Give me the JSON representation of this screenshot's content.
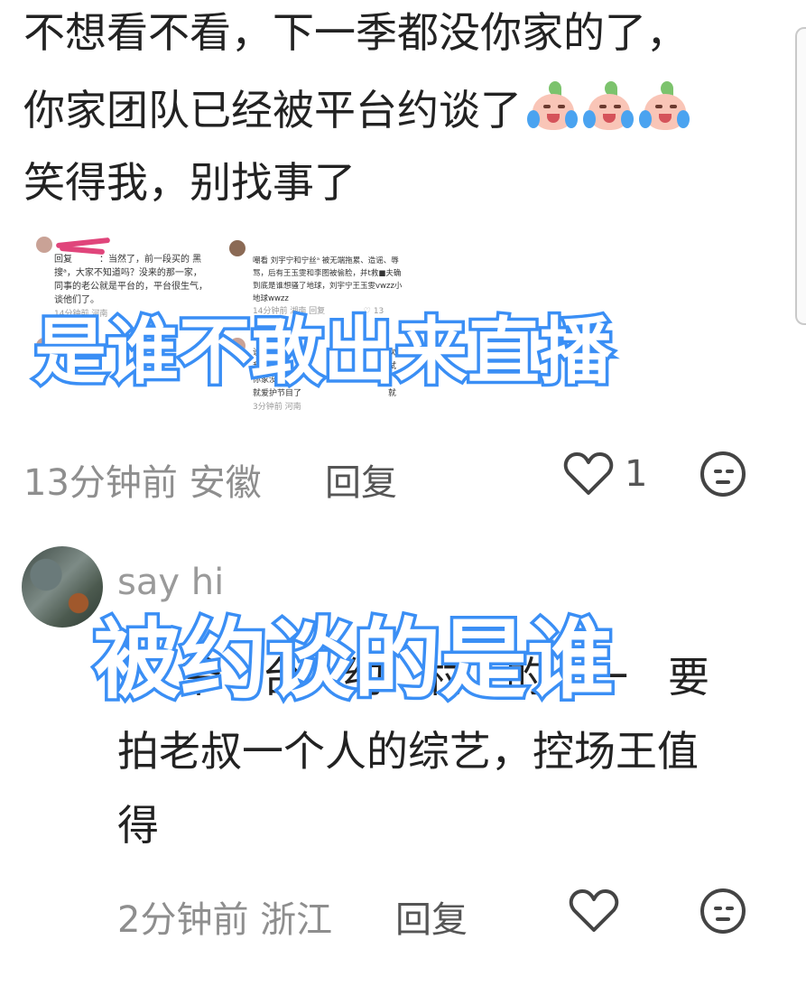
{
  "comment1": {
    "lines": [
      "不想看不看，下一季都没你家的了，",
      "你家团队已经被平台约谈了",
      "笑得我，别找事了"
    ],
    "emoji": [
      "crying-laughing-peach-emoji",
      "crying-laughing-peach-emoji",
      "crying-laughing-peach-emoji"
    ],
    "embedded_screenshot": {
      "left": {
        "reply": "回复",
        "text_lines": [
          "：当然了，前一段买的 黑",
          "搜ᵃ，大家不知道吗？没来的那一家，",
          "同事的老公就是平台的，平台很生气，",
          "谈他们了。"
        ],
        "meta": "14分钟前  河南",
        "extra_line": "他"
      },
      "right": {
        "text_lines": [
          "嘲看 刘宇宁和宁丝ᵃ 被无端拖累、造谣、辱",
          "骂，后有王玉雯和李图被偷脸，并t救■夫确",
          "到底是谁想骚了地球，刘宇宁王玉雯vwzz小",
          "地球wwzz"
        ],
        "meta": "14分钟前 湖南    回复",
        "count": "13",
        "lower_lines": [
          "说下沉",
          "我朋友",
          "你家没吃看",
          "就爱护节目了"
        ],
        "lower_meta": "3分钟前  河南",
        "side_chars": [
          "次",
          "试",
          "就"
        ]
      },
      "overlay": "是谁不敢出来直播"
    },
    "time": "13分钟前",
    "location": "安徽",
    "reply_label": "回复",
    "like_count": "1"
  },
  "comment2": {
    "username": "say hi",
    "hidden_line_fragments": [
      "爷",
      "台",
      "约",
      "村",
      "的",
      "一",
      "要"
    ],
    "lines": [
      "拍老叔一个人的综艺，控场王值",
      "得"
    ],
    "overlay": "被约谈的是谁",
    "time": "2分钟前",
    "location": "浙江",
    "reply_label": "回复"
  },
  "colors": {
    "overlay_stroke": "#3b8ff5",
    "scribble": "#e0457b"
  }
}
